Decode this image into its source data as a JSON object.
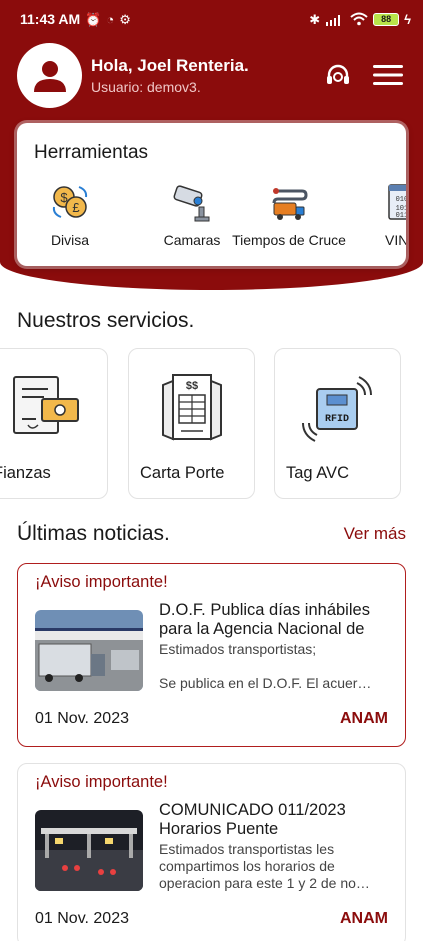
{
  "status_bar": {
    "time": "11:43 AM",
    "battery": "88"
  },
  "profile": {
    "greeting": "Hola, Joel Renteria.",
    "user": "Usuario: demov3."
  },
  "tools": {
    "title": "Herramientas",
    "items": [
      {
        "label": "Divisa",
        "icon": "currency-exchange-icon"
      },
      {
        "label": "Camaras",
        "icon": "security-camera-icon"
      },
      {
        "label": "Tiempos de Cruce",
        "icon": "truck-route-icon"
      },
      {
        "label": "VIN De",
        "icon": "vin-decoder-icon"
      }
    ]
  },
  "services": {
    "title": "Nuestros servicios.",
    "items": [
      {
        "label": "Fianzas",
        "icon": "bond-document-icon"
      },
      {
        "label": "Carta Porte",
        "icon": "invoice-icon"
      },
      {
        "label": "Tag AVC",
        "icon": "rfid-tag-icon"
      }
    ]
  },
  "news": {
    "title": "Últimas noticias.",
    "see_more": "Ver más",
    "items": [
      {
        "tag": "¡Aviso importante!",
        "title": "D.O.F. Publica días inhábiles para la Agencia Nacional de",
        "body": "Estimados transportistas;\n\nSe publica en el D.O.F. El acuer…",
        "date": "01 Nov. 2023",
        "source": "ANAM"
      },
      {
        "tag": "¡Aviso importante!",
        "title": "COMUNICADO 011/2023 Horarios Puente",
        "body": "Estimados transportistas les compartimos los horarios de operacion para este 1 y 2 de no…",
        "date": "01 Nov. 2023",
        "source": "ANAM"
      }
    ]
  },
  "colors": {
    "brand": "#8b0c0c",
    "accent_text": "#8b0c0c"
  }
}
